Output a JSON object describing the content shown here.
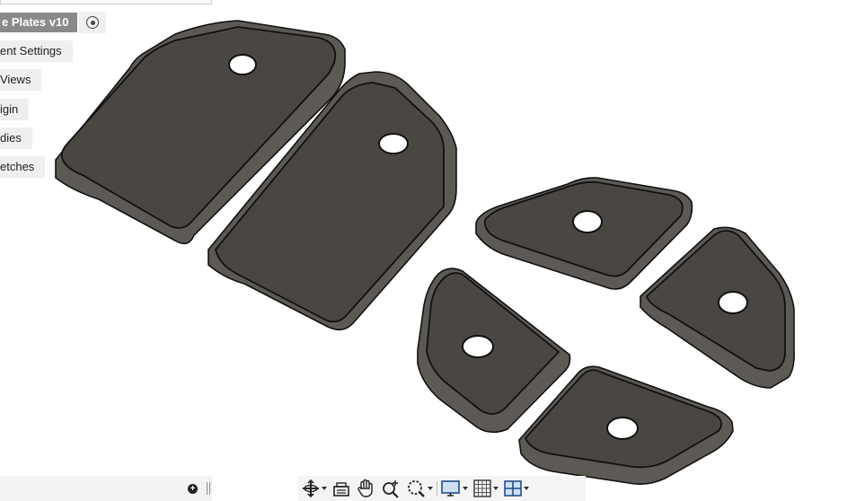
{
  "browser": {
    "document_title": "e Plates v10",
    "items": [
      {
        "label": "ent Settings"
      },
      {
        "label": "Views"
      },
      {
        "label": "igin"
      },
      {
        "label": "dies"
      },
      {
        "label": "etches"
      }
    ]
  },
  "viewport": {
    "body_fill": "#4a4743",
    "edge_fill": "#5d5955",
    "outline": "#111111"
  },
  "navbar": {
    "icons": [
      "orbit-icon",
      "look-at-icon",
      "pan-icon",
      "zoom-icon",
      "zoom-window-icon",
      "display-settings-icon",
      "grid-settings-icon",
      "viewports-icon"
    ]
  }
}
